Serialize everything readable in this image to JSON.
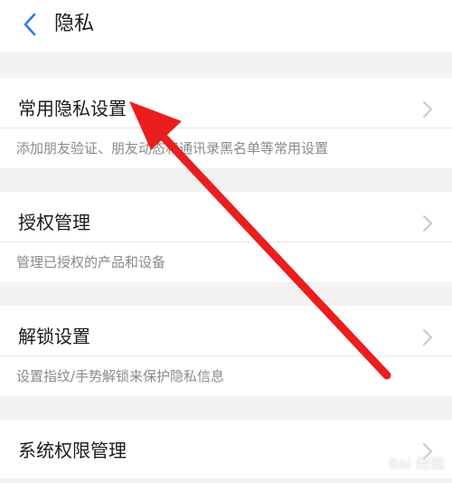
{
  "header": {
    "title": "隐私"
  },
  "sections": [
    {
      "label": "常用隐私设置",
      "description": "添加朋友验证、朋友动态和通讯录黑名单等常用设置"
    },
    {
      "label": "授权管理",
      "description": "管理已授权的产品和设备"
    },
    {
      "label": "解锁设置",
      "description": "设置指纹/手势解锁来保护隐私信息"
    },
    {
      "label": "系统权限管理"
    }
  ],
  "colors": {
    "background": "#f2f2f2",
    "surface": "#ffffff",
    "accent": "#2f7be8",
    "annotation_arrow": "#ea1e1e"
  },
  "watermark": "Bai 经验"
}
